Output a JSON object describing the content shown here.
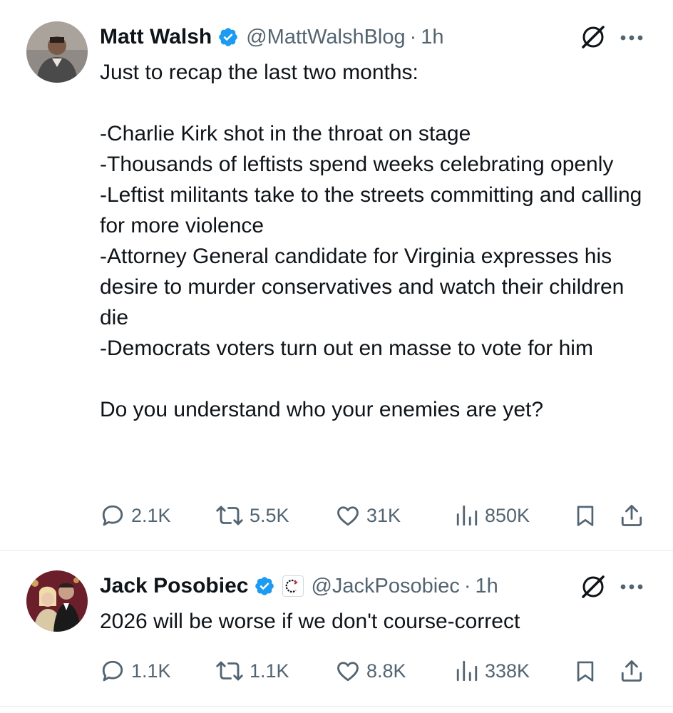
{
  "tweets": [
    {
      "author_name": "Matt Walsh",
      "handle": "@MattWalshBlog",
      "separator": "·",
      "time": "1h",
      "text": "Just to recap the last two months:\n\n-Charlie Kirk shot in the throat on stage\n-Thousands of leftists spend weeks celebrating openly\n-Leftist militants take to the streets committing and calling for more violence\n-Attorney General candidate for Virginia expresses his desire to murder conservatives and watch their children die\n-Democrats voters turn out en masse to vote for him\n\nDo you understand who your enemies are yet?",
      "replies": "2.1K",
      "reposts": "5.5K",
      "likes": "31K",
      "views": "850K"
    },
    {
      "author_name": "Jack Posobiec",
      "handle": "@JackPosobiec",
      "separator": "·",
      "time": "1h",
      "text": "2026 will be worse if we don't course-correct",
      "replies": "1.1K",
      "reposts": "1.1K",
      "likes": "8.8K",
      "views": "338K"
    }
  ],
  "icons": {
    "verified": "verified-badge-icon",
    "affiliation": "affiliation-badge-icon",
    "grok": "grok-icon",
    "more": "more-icon",
    "reply": "reply-icon",
    "repost": "repost-icon",
    "like": "like-icon",
    "views": "views-icon",
    "bookmark": "bookmark-icon",
    "share": "share-icon"
  },
  "colors": {
    "text": "#0f1419",
    "secondary": "#536471",
    "verified": "#1d9bf0",
    "divider": "#e7e9ea"
  }
}
